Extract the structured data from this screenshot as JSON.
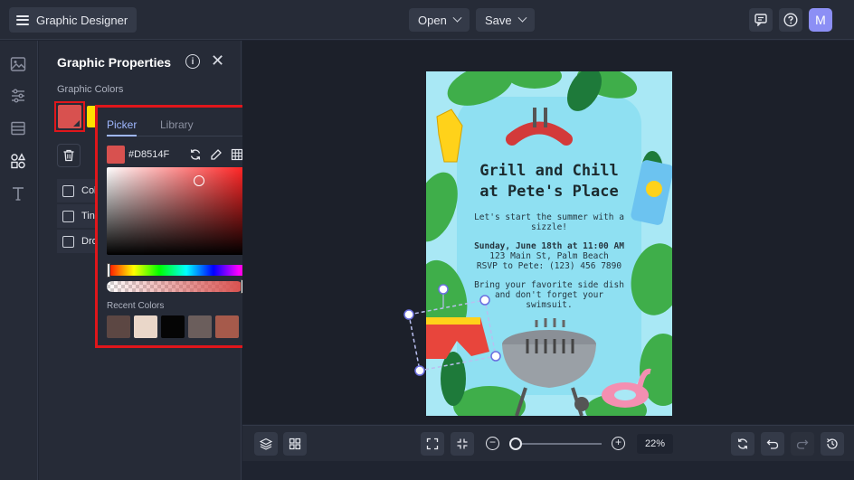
{
  "app": {
    "title": "Graphic Designer"
  },
  "toolbar": {
    "open_label": "Open",
    "save_label": "Save",
    "avatar_initial": "M"
  },
  "panel": {
    "title": "Graphic Properties",
    "section_label": "Graphic Colors",
    "checkboxes": [
      {
        "label": "Col"
      },
      {
        "label": "Tin"
      },
      {
        "label": "Dro"
      }
    ]
  },
  "picker": {
    "tabs": [
      {
        "label": "Picker",
        "active": true
      },
      {
        "label": "Library",
        "active": false
      }
    ],
    "hex": "#D8514F",
    "alpha": "100",
    "recent_label": "Recent Colors",
    "recent_colors": [
      "#5c4743",
      "#ead7c9",
      "#050505",
      "#6b5e5c",
      "#a65a4b",
      "#c9174f"
    ]
  },
  "poster": {
    "title_line1": "Grill and Chill",
    "title_line2": "at Pete's Place",
    "intro": [
      "Let's start the summer with a",
      "sizzle!"
    ],
    "date_line": "Sunday, June 18th at 11:00 AM",
    "address": "123 Main St, Palm Beach",
    "rsvp": "RSVP to Pete: (123) 456 7890",
    "closing": [
      "Bring your favorite side dish",
      "and don't forget your",
      "swimsuit."
    ]
  },
  "bottom": {
    "zoom": "22%"
  },
  "colors": {
    "accent": "#9fb7ff",
    "highlight": "#e0161b",
    "avatar": "#8c8ff5",
    "selected_color": "#D8514F"
  }
}
